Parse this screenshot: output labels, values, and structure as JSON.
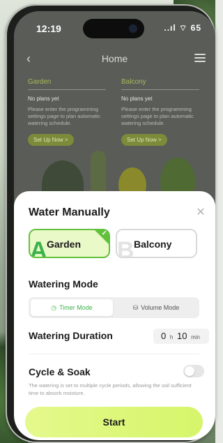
{
  "status_bar": {
    "time": "12:19",
    "icons": "..ıl ⌔ 65"
  },
  "home": {
    "title": "Home",
    "zones": [
      {
        "name": "Garden",
        "plan_status": "No plans yet",
        "description": "Please enter the programming settings page to plan automatic watering schedule.",
        "button": "Set Up Now >"
      },
      {
        "name": "Balcony",
        "plan_status": "No plans yet",
        "description": "Please enter the programming settings page to plan automatic watering schedule.",
        "button": "Set Up Now >"
      }
    ]
  },
  "sheet": {
    "title": "Water Manually",
    "zones": [
      {
        "letter": "A",
        "name": "Garden",
        "selected": true
      },
      {
        "letter": "B",
        "name": "Balcony",
        "selected": false
      }
    ],
    "watering_mode_label": "Watering Mode",
    "modes": [
      {
        "label": "Timer Mode",
        "icon": "clock-icon",
        "active": true
      },
      {
        "label": "Volume Mode",
        "icon": "volume-icon",
        "active": false
      }
    ],
    "duration": {
      "label": "Watering Duration",
      "hours": "0",
      "hours_unit": "h",
      "minutes": "10",
      "minutes_unit": "min"
    },
    "cycle": {
      "label": "Cycle & Soak",
      "enabled": false,
      "description": "The watering is set to multiple cycle periods, allowing the soil sufficient time to absorb moisture."
    },
    "start_label": "Start"
  },
  "colors": {
    "accent_green": "#3bb34a",
    "selected_border": "#62c13c",
    "start_button": "#d6f56a"
  }
}
